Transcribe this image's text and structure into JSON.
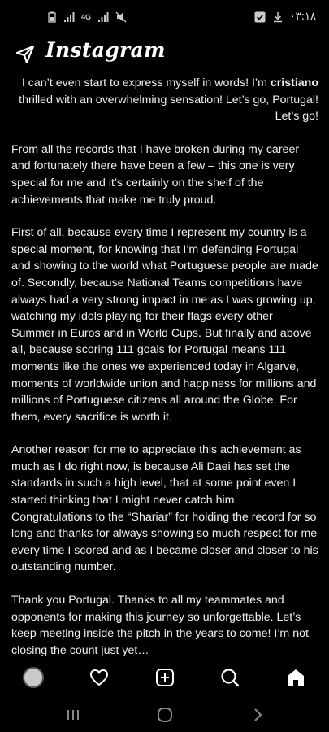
{
  "status_bar": {
    "time": "۰۳:۱۸",
    "network_label": "4G",
    "icons": [
      "battery-icon",
      "signal-icon",
      "mute-icon",
      "check-icon",
      "download-icon"
    ]
  },
  "header": {
    "app_title": "Instagram",
    "back_icon": "send-arrow-icon"
  },
  "post": {
    "author": "cristiano",
    "first_line_pre": "I can’t even start to express myself in words! I’m ",
    "first_line_post": " thrilled with an overwhelming sensation! Let’s go, Portugal! Let’s go!",
    "paragraphs": [
      "From all the records that I have broken during my career – and fortunately there have been a few – this one is very special for me and it’s certainly on the shelf of the achievements that make me truly proud.",
      "First of all, because every time I represent my country is a special moment, for knowing that I’m defending Portugal and showing to the world what Portuguese people are made of. Secondly, because National Teams competitions have always had a very strong impact in me as I was growing up, watching my idols playing for their flags every other Summer in Euros and in World Cups. But finally and above all, because scoring 111 goals for Portugal means 111 moments like the ones we experienced today in Algarve, moments of worldwide union and happiness for millions and millions of Portuguese citizens all around the Globe. For them, every sacrifice is worth it.",
      "Another reason for me to appreciate this achievement as much as I do right now, is because Ali Daei has set the standards in such a high level, that at some point even I started thinking that I might never catch him. Congratulations to the “Shariar” for holding the record for so long and thanks for always showing so much respect for me every time I scored and as I became closer and closer to his outstanding number.",
      "Thank you Portugal. Thanks to all my teammates and opponents for making this journey so unforgettable. Let’s keep meeting inside the pitch in the years to come! I’m not closing the count just yet…"
    ]
  },
  "bottom_nav": {
    "items": [
      "profile-avatar",
      "heart-icon",
      "add-post-icon",
      "search-icon",
      "home-icon"
    ]
  },
  "system_nav": {
    "items": [
      "recents-icon",
      "home-circle-icon",
      "back-chevron-icon"
    ]
  }
}
